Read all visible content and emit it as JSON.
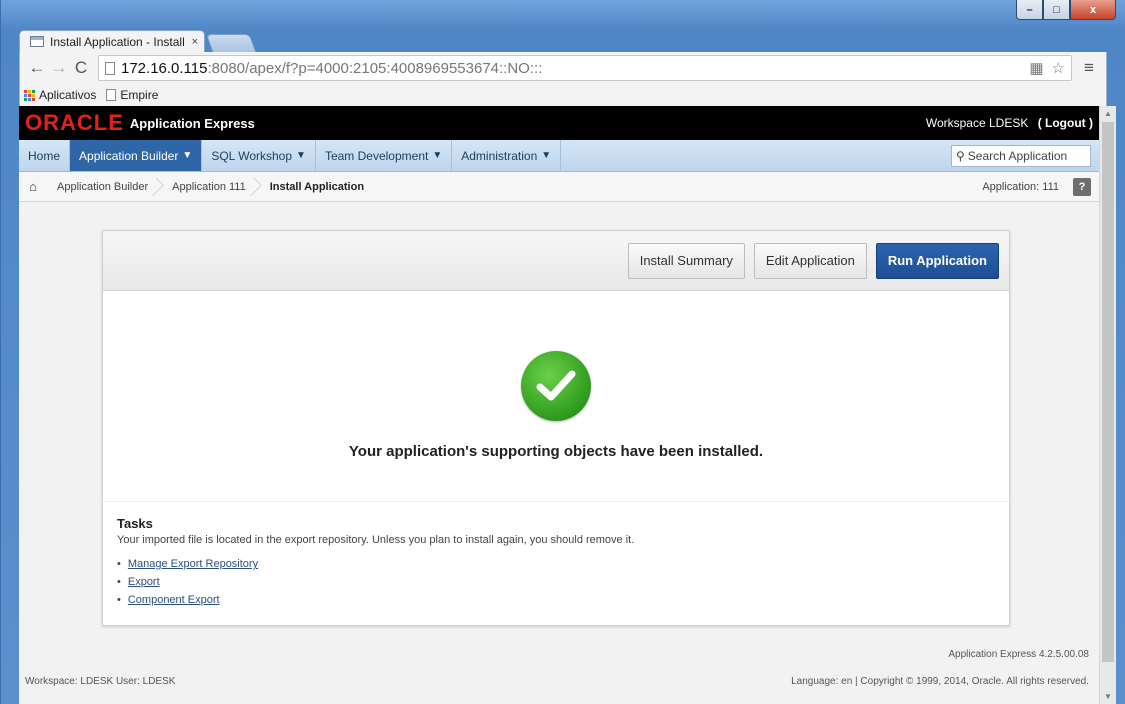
{
  "browser": {
    "tab_title": "Install Application - Install",
    "tab_close": "×",
    "url_host": "172.16.0.115",
    "url_rest": ":8080/apex/f?p=4000:2105:4008969553674::NO:::",
    "bookmarks": [
      "Aplicativos",
      "Empire"
    ],
    "window_buttons": {
      "minimize": "–",
      "maximize": "□",
      "close": "x"
    }
  },
  "apex": {
    "logo": "ORACLE",
    "product": "Application Express",
    "workspace": "Workspace LDESK",
    "logout": "( Logout )",
    "nav": [
      "Home",
      "Application Builder",
      "SQL Workshop",
      "Team Development",
      "Administration"
    ],
    "active_nav": "Application Builder",
    "search_placeholder": "Search Application",
    "breadcrumb": [
      "Application Builder",
      "Application 111"
    ],
    "breadcrumb_current": "Install Application",
    "application_label": "Application: 111",
    "help": "?"
  },
  "region": {
    "buttons": {
      "install_summary": "Install Summary",
      "edit_application": "Edit Application",
      "run_application": "Run Application"
    },
    "success_message": "Your application's supporting objects have been installed.",
    "tasks_title": "Tasks",
    "tasks_text": "Your imported file is located in the export repository. Unless you plan to install again, you should remove it.",
    "tasks_links": [
      "Manage Export Repository",
      "Export",
      "Component Export"
    ]
  },
  "footer": {
    "version": "Application Express 4.2.5.00.08",
    "user_info": "Workspace: LDESK User: LDESK",
    "copyright": "Language: en | Copyright © 1999, 2014, Oracle. All rights reserved."
  },
  "colors": {
    "oracle_red": "#e2201c",
    "nav_active": "#2f66a8",
    "hot_button": "#1d4f93",
    "success_green": "#2e9a1c"
  }
}
